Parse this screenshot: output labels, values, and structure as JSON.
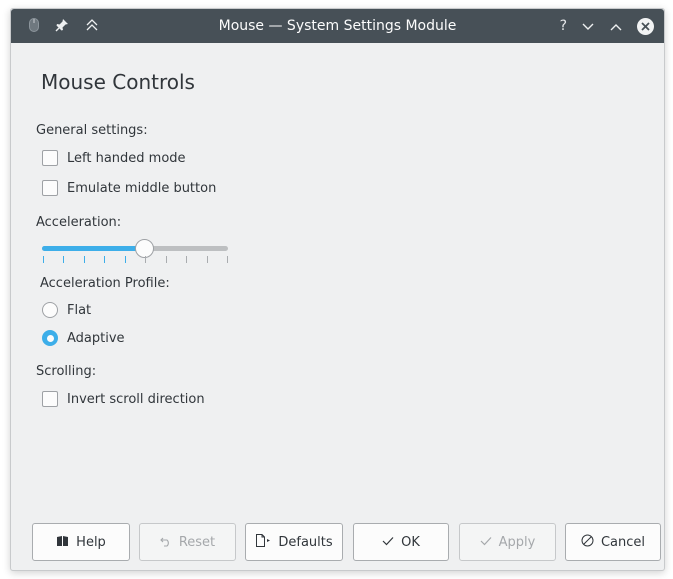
{
  "titlebar": {
    "title": "Mouse — System Settings Module",
    "left_icons": [
      "mouse-icon",
      "pin-icon",
      "keep-above-icon"
    ],
    "right_icons": [
      "help-icon",
      "minimize-icon",
      "maximize-icon",
      "close-icon"
    ],
    "help_glyph": "?",
    "minimize_glyph": "⌄",
    "maximize_glyph": "⌃"
  },
  "page": {
    "title": "Mouse Controls"
  },
  "general": {
    "heading": "General settings:",
    "options": [
      {
        "label": "Left handed mode",
        "checked": false
      },
      {
        "label": "Emulate middle button",
        "checked": false
      }
    ]
  },
  "acceleration": {
    "heading": "Acceleration:",
    "slider_fraction": 0.55,
    "tick_count": 10,
    "profile_heading": "Acceleration Profile:",
    "profiles": [
      {
        "label": "Flat",
        "selected": false
      },
      {
        "label": "Adaptive",
        "selected": true
      }
    ]
  },
  "scrolling": {
    "heading": "Scrolling:",
    "options": [
      {
        "label": "Invert scroll direction",
        "checked": false
      }
    ]
  },
  "buttons": {
    "help": {
      "label": "Help",
      "icon": "help-book-icon",
      "enabled": true
    },
    "reset": {
      "label": "Reset",
      "icon": "undo-icon",
      "enabled": false
    },
    "defaults": {
      "label": "Defaults",
      "icon": "document-defaults-icon",
      "enabled": true
    },
    "ok": {
      "label": "OK",
      "icon": "check-icon",
      "enabled": true
    },
    "apply": {
      "label": "Apply",
      "icon": "check-icon",
      "enabled": false
    },
    "cancel": {
      "label": "Cancel",
      "icon": "cancel-icon",
      "enabled": true
    }
  },
  "colors": {
    "accent": "#3daee9",
    "titlebar": "#475057",
    "window_bg": "#eff0f1",
    "text": "#31363b"
  }
}
